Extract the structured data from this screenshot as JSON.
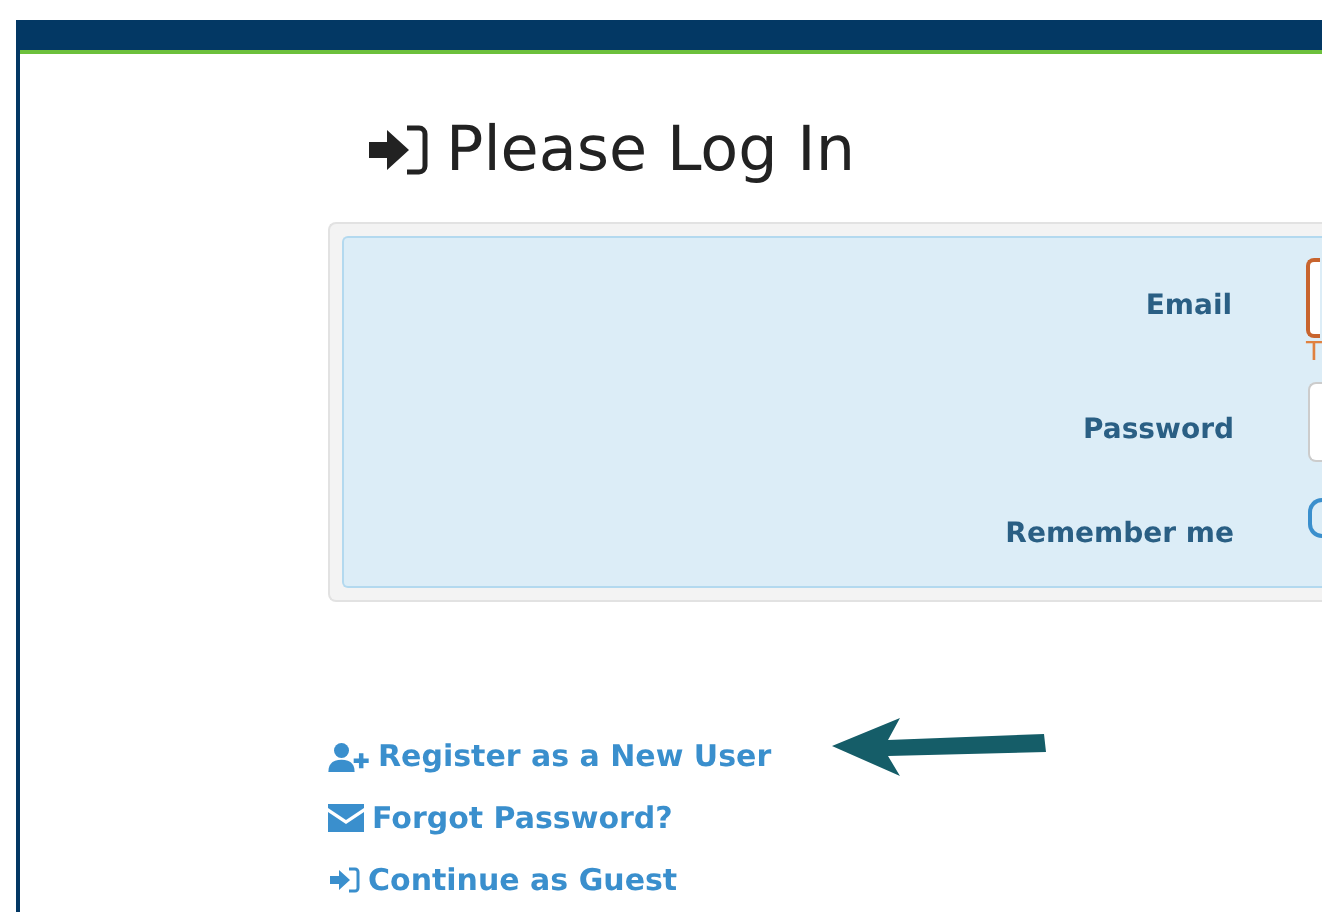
{
  "title": "Please Log In",
  "form": {
    "fields": [
      {
        "kind": "text",
        "label": "Email",
        "invalid": true,
        "error": "T"
      },
      {
        "kind": "text",
        "label": "Password",
        "invalid": false
      },
      {
        "kind": "toggle",
        "label": "Remember me",
        "checked": false
      }
    ]
  },
  "links": [
    {
      "kind": "register",
      "label": "Register as a New User",
      "pointer": true
    },
    {
      "kind": "forgot",
      "label": "Forgot Password?",
      "pointer": false
    },
    {
      "kind": "guest",
      "label": "Continue as Guest",
      "pointer": false
    }
  ]
}
